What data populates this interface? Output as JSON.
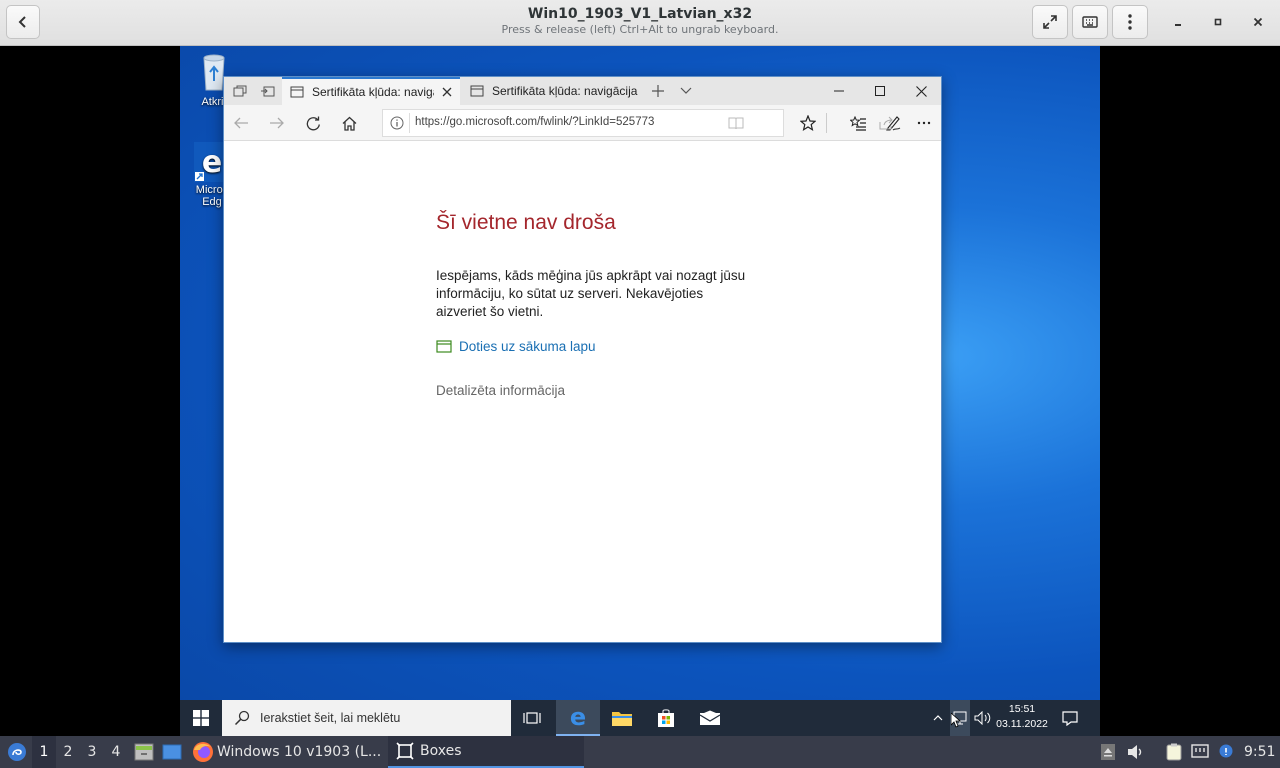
{
  "boxes": {
    "title": "Win10_1903_V1_Latvian_x32",
    "subtitle": "Press & release (left) Ctrl+Alt to ungrab keyboard.",
    "icons": {
      "back": "chevron-left-icon",
      "fullscreen": "fullscreen-icon",
      "keyboard": "keyboard-icon",
      "menu": "kebab-menu-icon",
      "minimize": "minimize-icon",
      "maximize": "maximize-icon",
      "close": "close-icon"
    }
  },
  "desktop": {
    "recycle_bin_label": "Atkrit",
    "edge_label_1": "Micros",
    "edge_label_2": "Edg"
  },
  "edge": {
    "tabs": [
      {
        "label": "Sertifikāta kļūda: navigā"
      },
      {
        "label": "Sertifikāta kļūda: navigācija"
      }
    ],
    "url": "https://go.microsoft.com/fwlink/?LinkId=525773",
    "page": {
      "heading": "Šī vietne nav droša",
      "body": "Iespējams, kāds mēģina jūs apkrāpt vai nozagt jūsu informāciju, ko sūtat uz serveri. Nekavējoties aizveriet šo vietni.",
      "home_link": "Doties uz sākuma lapu",
      "details_link": "Detalizēta informācija"
    },
    "colors": {
      "heading": "#a4262c",
      "link": "#1a6fb3",
      "details": "#666666",
      "tab_accent": "#2b79d0"
    }
  },
  "win_taskbar": {
    "search_placeholder": "Ierakstiet šeit, lai meklētu",
    "clock_time": "15:51",
    "clock_date": "03.11.2022"
  },
  "host_panel": {
    "workspaces": [
      "1",
      "2",
      "3",
      "4"
    ],
    "tasks": [
      {
        "label": "Windows 10 v1903 (L...",
        "icon": "firefox-icon"
      },
      {
        "label": "Boxes",
        "icon": "boxes-icon"
      }
    ],
    "clock": "9:51"
  }
}
